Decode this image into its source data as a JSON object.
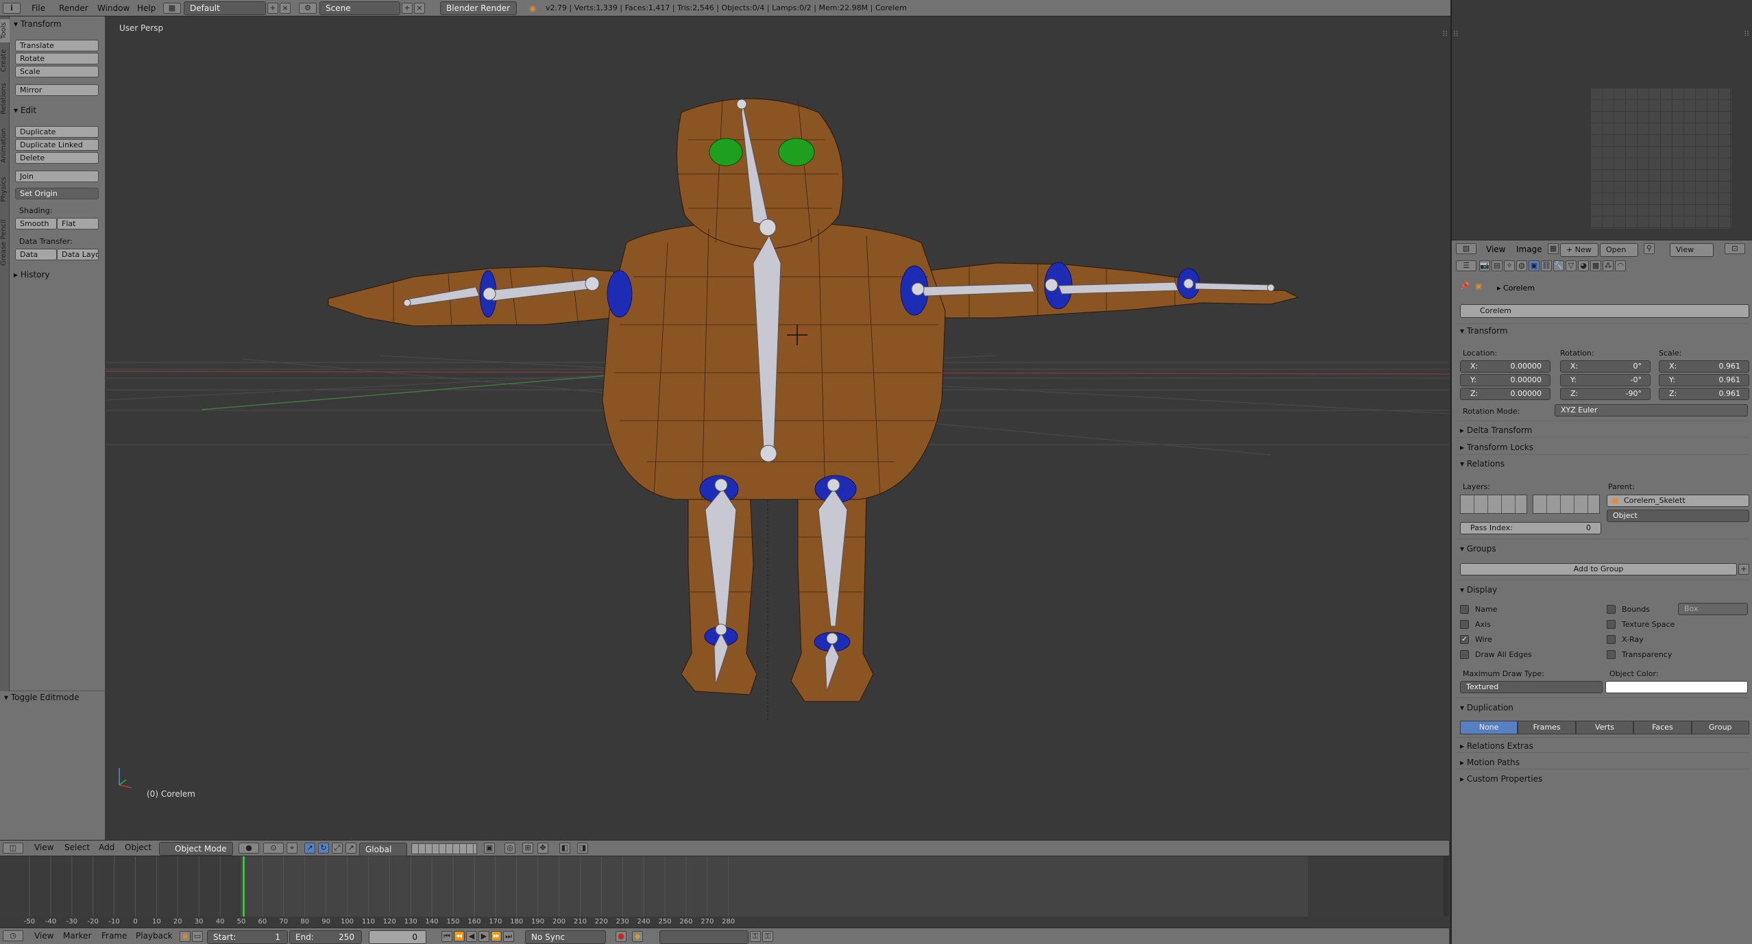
{
  "topbar": {
    "menus": [
      "File",
      "Render",
      "Window",
      "Help"
    ],
    "screen_layout": "Default",
    "scene": "Scene",
    "render_engine": "Blender Render",
    "stats": "v2.79 | Verts:1,339 | Faces:1,417 | Tris:2,546 | Objects:0/4 | Lamps:0/2 | Mem:22.98M | Corelem"
  },
  "left_tabs": [
    "Tools",
    "Create",
    "Relations",
    "Animation",
    "Physics",
    "Grease Pencil"
  ],
  "tool_shelf": {
    "transform_header": "Transform",
    "translate": "Translate",
    "rotate": "Rotate",
    "scale": "Scale",
    "mirror": "Mirror",
    "edit_header": "Edit",
    "duplicate": "Duplicate",
    "duplicate_linked": "Duplicate Linked",
    "delete": "Delete",
    "join": "Join",
    "set_origin": "Set Origin",
    "shading_label": "Shading:",
    "smooth": "Smooth",
    "flat": "Flat",
    "data_transfer_label": "Data Transfer:",
    "data": "Data",
    "data_layout": "Data Layo",
    "history_header": "History",
    "toggle_editmode": "Toggle Editmode"
  },
  "viewport": {
    "view_name": "User Persp",
    "object_label": "(0) Corelem"
  },
  "view3d_header": {
    "view": "View",
    "select": "Select",
    "add": "Add",
    "object": "Object",
    "mode": "Object Mode",
    "orientation": "Global"
  },
  "timeline": {
    "ticks": [
      "-50",
      "-40",
      "-30",
      "-20",
      "-10",
      "0",
      "10",
      "20",
      "30",
      "40",
      "50",
      "60",
      "70",
      "80",
      "90",
      "100",
      "110",
      "120",
      "130",
      "140",
      "150",
      "160",
      "170",
      "180",
      "190",
      "200",
      "210",
      "220",
      "230",
      "240",
      "250",
      "260",
      "270",
      "280"
    ],
    "view": "View",
    "marker": "Marker",
    "frame": "Frame",
    "playback": "Playback",
    "start_label": "Start:",
    "start_value": "1",
    "end_label": "End:",
    "end_value": "250",
    "current_frame": "0",
    "sync": "No Sync"
  },
  "uv_header": {
    "view": "View",
    "image": "Image",
    "new": "New",
    "open": "Open",
    "view2": "View"
  },
  "properties": {
    "breadcrumb": "Corelem",
    "object_name": "Corelem",
    "transform_header": "Transform",
    "location_label": "Location:",
    "rotation_label": "Rotation:",
    "scale_label": "Scale:",
    "location": [
      {
        "k": "X:",
        "v": "0.00000"
      },
      {
        "k": "Y:",
        "v": "0.00000"
      },
      {
        "k": "Z:",
        "v": "0.00000"
      }
    ],
    "rotation": [
      {
        "k": "X:",
        "v": "0°"
      },
      {
        "k": "Y:",
        "v": "-0°"
      },
      {
        "k": "Z:",
        "v": "-90°"
      }
    ],
    "scale": [
      {
        "k": "X:",
        "v": "0.961"
      },
      {
        "k": "Y:",
        "v": "0.961"
      },
      {
        "k": "Z:",
        "v": "0.961"
      }
    ],
    "rotation_mode_label": "Rotation Mode:",
    "rotation_mode": "XYZ Euler",
    "delta_transform": "Delta Transform",
    "transform_locks": "Transform Locks",
    "relations_header": "Relations",
    "layers_label": "Layers:",
    "parent_label": "Parent:",
    "parent": "Corelem_Skelett",
    "parent_type": "Object",
    "pass_index_label": "Pass Index:",
    "pass_index": "0",
    "groups_header": "Groups",
    "add_to_group": "Add to Group",
    "display_header": "Display",
    "display_left": [
      {
        "label": "Name",
        "checked": false
      },
      {
        "label": "Axis",
        "checked": false
      },
      {
        "label": "Wire",
        "checked": true
      },
      {
        "label": "Draw All Edges",
        "checked": false
      }
    ],
    "display_right": [
      {
        "label": "Bounds",
        "checked": false
      },
      {
        "label": "Texture Space",
        "checked": false
      },
      {
        "label": "X-Ray",
        "checked": false
      },
      {
        "label": "Transparency",
        "checked": false
      }
    ],
    "bounds_type": "Box",
    "max_draw_type_label": "Maximum Draw Type:",
    "max_draw_type": "Textured",
    "object_color_label": "Object Color:",
    "object_color": "#ffffff",
    "duplication_header": "Duplication",
    "duplication_options": [
      "None",
      "Frames",
      "Verts",
      "Faces",
      "Group"
    ],
    "duplication_selected": "None",
    "relations_extras": "Relations Extras",
    "motion_paths": "Motion Paths",
    "custom_properties": "Custom Properties"
  },
  "colors": {
    "accent": "#5680c2",
    "mesh": "#8a5423",
    "eyes": "#1ea01e",
    "joints": "#1c2cb5",
    "bones": "#c8c8d2"
  }
}
